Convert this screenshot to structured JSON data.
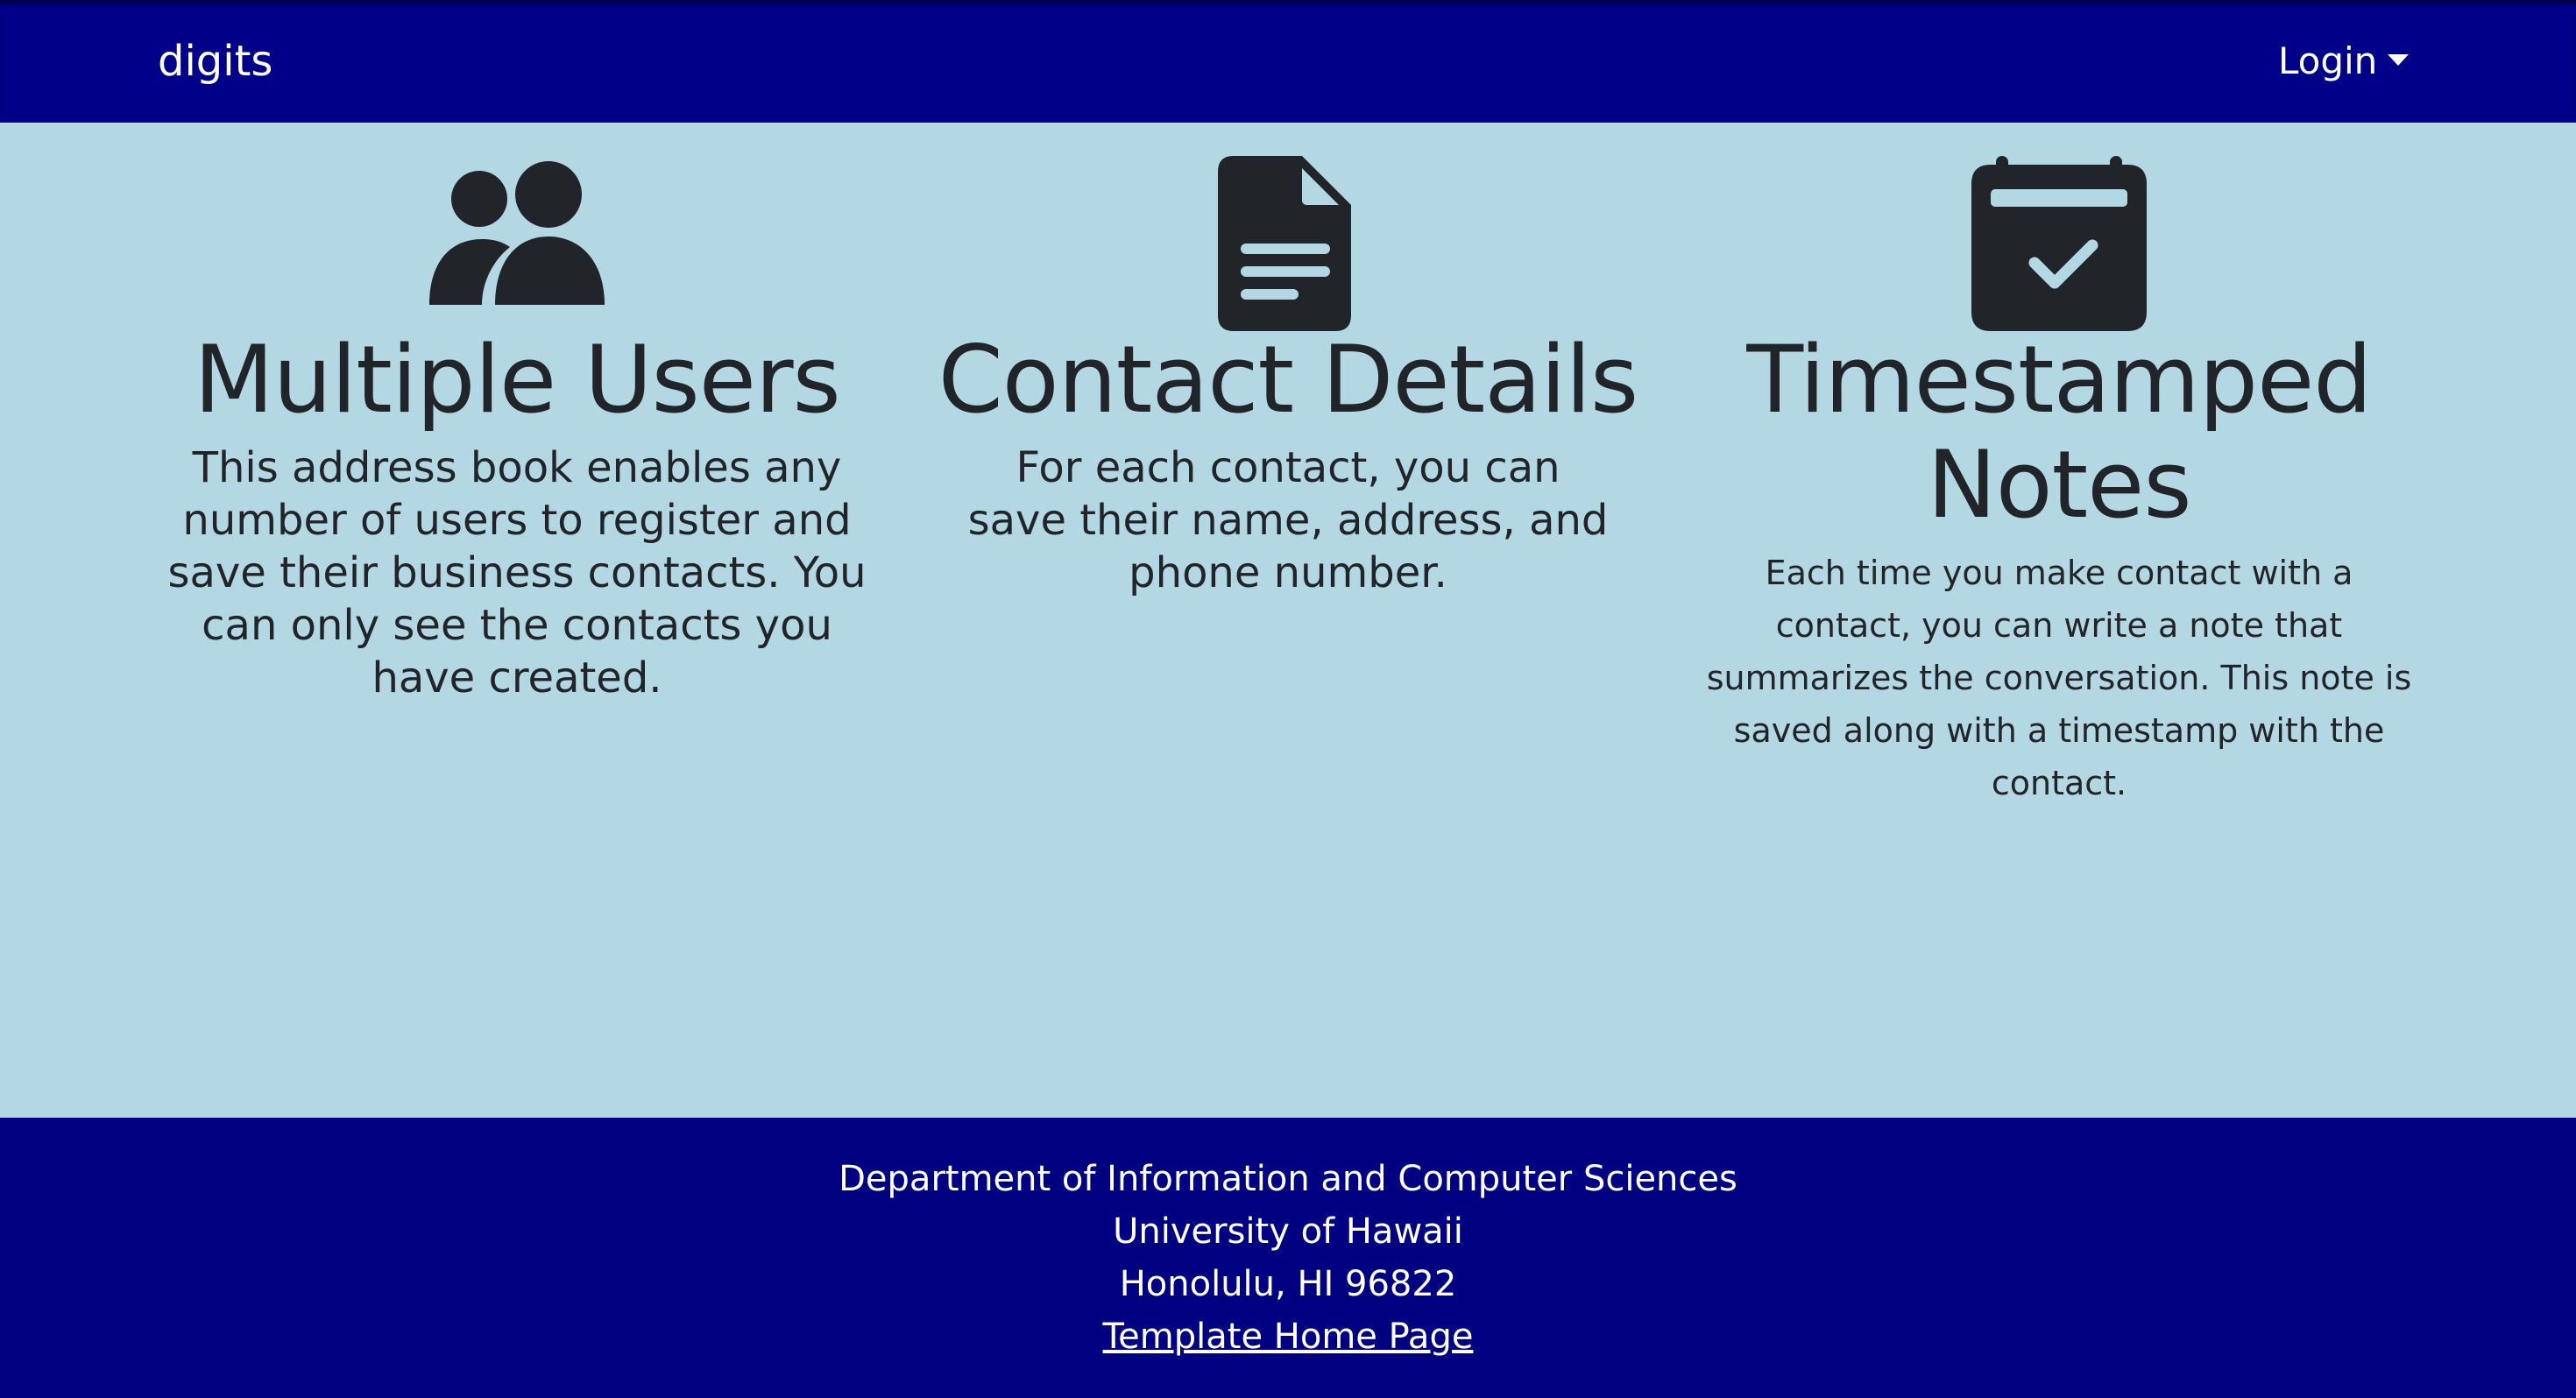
{
  "navbar": {
    "brand": "digits",
    "login_label": "Login",
    "background": "#000088"
  },
  "features": [
    {
      "icon": "people-fill-icon",
      "title": "Multiple Users",
      "description": "This address book enables any number of users to register and save their business contacts. You can only see the contacts you have created."
    },
    {
      "icon": "file-text-fill-icon",
      "title": "Contact Details",
      "description": "For each contact, you can save their name, address, and phone number."
    },
    {
      "icon": "calendar-check-fill-icon",
      "title": "Timestamped Notes",
      "description": "Each time you make contact with a contact, you can write a note that summarizes the conversation. This note is saved along with a timestamp with the contact."
    }
  ],
  "footer": {
    "line1": "Department of Information and Computer Sciences",
    "line2": "University of Hawaii",
    "line3": "Honolulu, HI 96822",
    "link_label": "Template Home Page",
    "background": "#000080"
  },
  "colors": {
    "page_background": "#b4d7e4",
    "text": "#212529"
  }
}
